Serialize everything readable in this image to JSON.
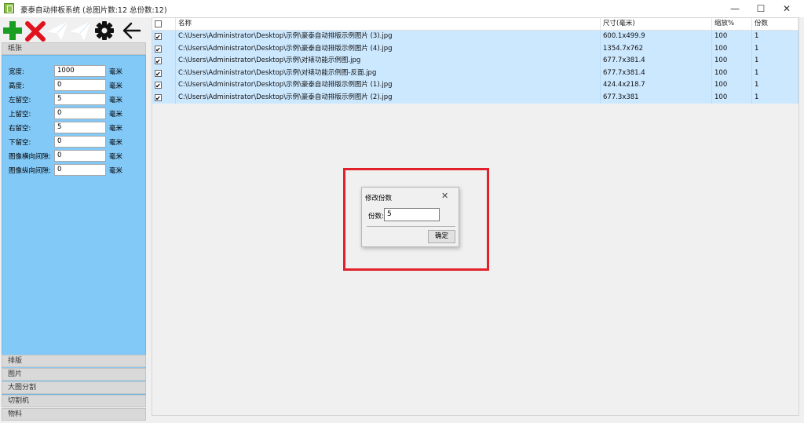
{
  "window": {
    "title": "豪泰自动排板系统 (总图片数:12 总份数:12)",
    "minimize_glyph": "—",
    "maximize_glyph": "☐",
    "close_glyph": "✕"
  },
  "toolbar": {
    "icons": [
      "add-icon",
      "delete-icon",
      "send-icon",
      "send-outline-icon",
      "gear-icon",
      "back-arrow-icon"
    ],
    "colors": {
      "add": "#1a9e22",
      "delete": "#e0141f",
      "send": "#ffffff",
      "gear": "#111111"
    }
  },
  "sections": {
    "paper": "纸张",
    "layout": "排版",
    "images": "图片",
    "split": "大图分割",
    "cutter": "切割机",
    "material": "物料"
  },
  "paper_fields": [
    {
      "label": "宽度:",
      "value": "1000",
      "unit": "毫米"
    },
    {
      "label": "高度:",
      "value": "0",
      "unit": "毫米"
    },
    {
      "label": "左留空:",
      "value": "5",
      "unit": "毫米"
    },
    {
      "label": "上留空:",
      "value": "0",
      "unit": "毫米"
    },
    {
      "label": "右留空:",
      "value": "5",
      "unit": "毫米"
    },
    {
      "label": "下留空:",
      "value": "0",
      "unit": "毫米"
    },
    {
      "label": "图像横向间隙:",
      "value": "0",
      "unit": "毫米"
    },
    {
      "label": "图像纵向间隙:",
      "value": "0",
      "unit": "毫米"
    }
  ],
  "table": {
    "headers": {
      "name": "名称",
      "size": "尺寸(毫米)",
      "scale": "缩放%",
      "copies": "份数"
    },
    "rows": [
      {
        "checked": true,
        "name": "C:\\Users\\Administrator\\Desktop\\示例\\豪泰自动排版示例图片 (3).jpg",
        "size": "600.1x499.9",
        "scale": "100",
        "copies": "1"
      },
      {
        "checked": true,
        "name": "C:\\Users\\Administrator\\Desktop\\示例\\豪泰自动排版示例图片 (4).jpg",
        "size": "1354.7x762",
        "scale": "100",
        "copies": "1"
      },
      {
        "checked": true,
        "name": "C:\\Users\\Administrator\\Desktop\\示例\\对裱功能示例图.jpg",
        "size": "677.7x381.4",
        "scale": "100",
        "copies": "1"
      },
      {
        "checked": true,
        "name": "C:\\Users\\Administrator\\Desktop\\示例\\对裱功能示例图-反面.jpg",
        "size": "677.7x381.4",
        "scale": "100",
        "copies": "1"
      },
      {
        "checked": true,
        "name": "C:\\Users\\Administrator\\Desktop\\示例\\豪泰自动排版示例图片 (1).jpg",
        "size": "424.4x218.7",
        "scale": "100",
        "copies": "1"
      },
      {
        "checked": true,
        "name": "C:\\Users\\Administrator\\Desktop\\示例\\豪泰自动排版示例图片 (2).jpg",
        "size": "677.3x381",
        "scale": "100",
        "copies": "1"
      }
    ]
  },
  "dialog": {
    "title": "修改份数",
    "close_glyph": "✕",
    "label": "份数:",
    "value": "5",
    "ok_label": "确定"
  },
  "colors": {
    "highlight": "#e3212b",
    "panel": "#83c9f7",
    "row_selected": "#cce8ff"
  }
}
